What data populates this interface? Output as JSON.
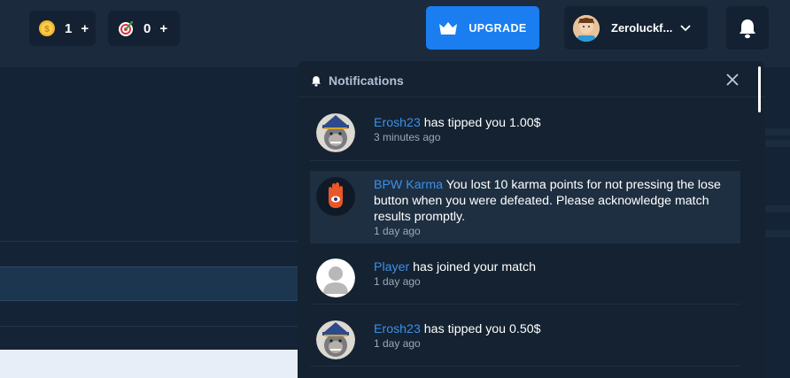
{
  "topbar": {
    "coins": {
      "count": "1",
      "plus": "+"
    },
    "targets": {
      "count": "0",
      "plus": "+"
    },
    "upgrade_label": "UPGRADE",
    "username": "Zeroluckf..."
  },
  "notifications": {
    "title": "Notifications",
    "items": [
      {
        "sender": "Erosh23",
        "message": " has tipped you 1.00$",
        "time": "3 minutes ago",
        "avatar": "gorilla-wizard-avatar"
      },
      {
        "sender": "BPW Karma",
        "message": " You lost 10 karma points for not pressing the lose button when you were defeated. Please acknowledge match results promptly.",
        "time": "1 day ago",
        "avatar": "hamsa-hand-avatar"
      },
      {
        "sender": "Player",
        "message": " has joined your match",
        "time": "1 day ago",
        "avatar": "default-user-avatar"
      },
      {
        "sender": "Erosh23",
        "message": " has tipped you 0.50$",
        "time": "1 day ago",
        "avatar": "gorilla-wizard-avatar"
      }
    ]
  },
  "colors": {
    "accent": "#1a7ef0",
    "link": "#3d8fe8",
    "panel_bg": "#142231",
    "topbar_bg": "#1b2b3d"
  }
}
